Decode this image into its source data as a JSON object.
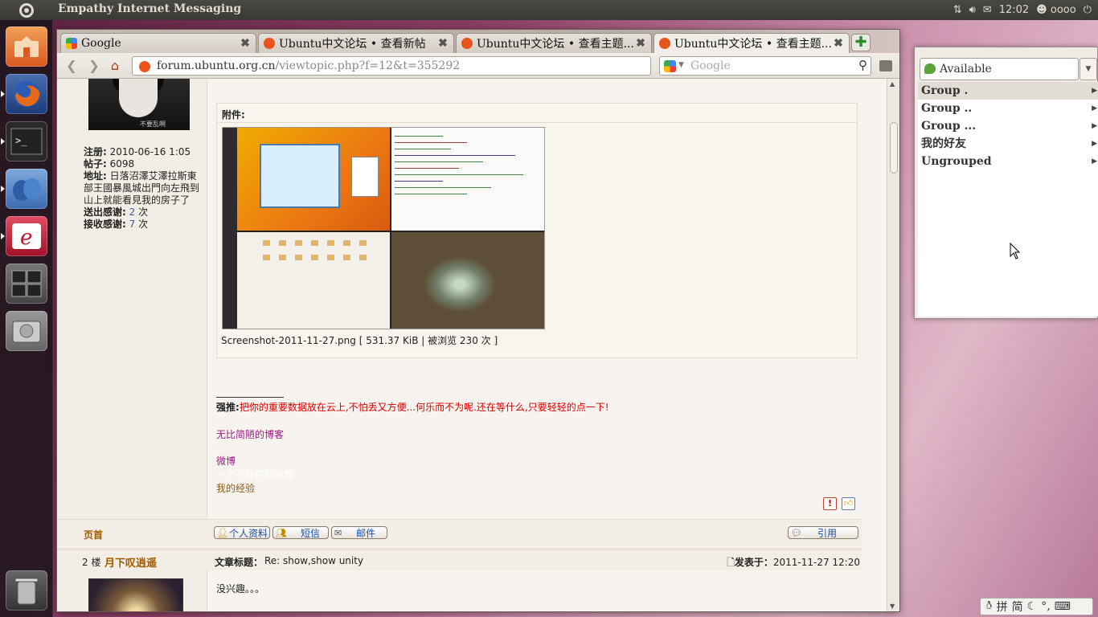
{
  "top_panel": {
    "app_title": "Empathy Internet Messaging",
    "clock": "12:02",
    "user": "oooo"
  },
  "launcher": {
    "items": [
      "home-folder",
      "firefox",
      "terminal",
      "empathy",
      "text-editor",
      "workspace-switcher",
      "disk",
      "trash"
    ]
  },
  "browser": {
    "tabs": [
      {
        "label": "Google",
        "close": "✖"
      },
      {
        "label": "Ubuntu中文论坛 • 查看新帖",
        "close": "✖"
      },
      {
        "label": "Ubuntu中文论坛 • 查看主题...",
        "close": "✖"
      },
      {
        "label": "Ubuntu中文论坛 • 查看主题...",
        "close": "✖"
      }
    ],
    "new_tab": "✚",
    "url_host": "forum.ubuntu.org.cn",
    "url_path": "/viewtopic.php?f=12&t=355292",
    "search_placeholder": "Google"
  },
  "post1": {
    "profile": {
      "reg_label": "注册:",
      "reg_value": " 2010-06-16 1:05",
      "posts_label": "帖子:",
      "posts_value": " 6098",
      "loc_label": "地址:",
      "loc_value": " 日落沼澤艾澤拉斯東部王國暴風城出門向左飛到山上就能看見我的房子了",
      "sent_label": "送出感谢:",
      "sent_value": "2",
      "sent_unit": " 次",
      "recv_label": "接收感谢:",
      "recv_value": "7",
      "recv_unit": " 次",
      "avatar_watermark": "不要乱啊"
    },
    "attachment_heading": "附件:",
    "attachment_caption": "Screenshot-2011-11-27.png [ 531.37 KiB | 被浏览 230 次 ]",
    "signature": {
      "prefix": "强推:",
      "promo": "把你的重要数据放在云上,不怕丢又方便...何乐而不为呢.还在等什么,只要轻轻的点一下!",
      "blog": "无比简陋的博客",
      "weibo": "微博",
      "hidden": "一个不存在的微博",
      "exp": "我的经验"
    },
    "footer": {
      "top_link": "页首",
      "profile_btn": "个人资料",
      "pm_btn": "短信",
      "email_btn": "邮件",
      "quote_btn": "引用"
    }
  },
  "post2": {
    "floor": "2 楼",
    "author": "月下叹逍遥",
    "subject_label": "文章标题：",
    "subject": "Re: show,show unity",
    "posted_label": "发表于：",
    "posted": "2011-11-27 12:20",
    "body": "没兴趣。。。"
  },
  "empathy": {
    "presence": "Available",
    "groups": [
      "Group .",
      "Group ..",
      "Group ...",
      "我的好友",
      "Ungrouped"
    ]
  },
  "ime": {
    "pin": "拼",
    "jian": "简"
  },
  "colors": {
    "accent_link": "#a0168a",
    "forum_orange": "#a25a00",
    "promo_red": "#dd0000"
  }
}
